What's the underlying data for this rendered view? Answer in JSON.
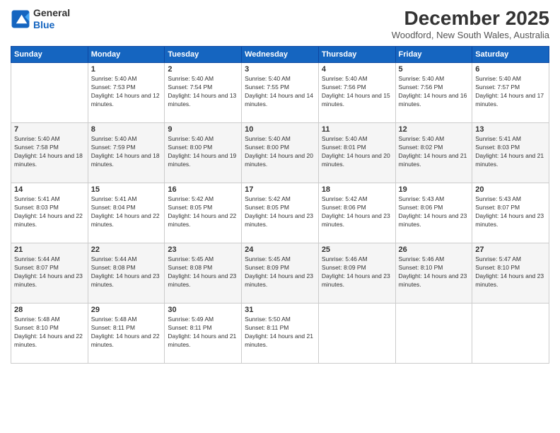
{
  "logo": {
    "line1": "General",
    "line2": "Blue"
  },
  "title": "December 2025",
  "subtitle": "Woodford, New South Wales, Australia",
  "days_header": [
    "Sunday",
    "Monday",
    "Tuesday",
    "Wednesday",
    "Thursday",
    "Friday",
    "Saturday"
  ],
  "weeks": [
    [
      {
        "day": "",
        "sunrise": "",
        "sunset": "",
        "daylight": ""
      },
      {
        "day": "1",
        "sunrise": "Sunrise: 5:40 AM",
        "sunset": "Sunset: 7:53 PM",
        "daylight": "Daylight: 14 hours and 12 minutes."
      },
      {
        "day": "2",
        "sunrise": "Sunrise: 5:40 AM",
        "sunset": "Sunset: 7:54 PM",
        "daylight": "Daylight: 14 hours and 13 minutes."
      },
      {
        "day": "3",
        "sunrise": "Sunrise: 5:40 AM",
        "sunset": "Sunset: 7:55 PM",
        "daylight": "Daylight: 14 hours and 14 minutes."
      },
      {
        "day": "4",
        "sunrise": "Sunrise: 5:40 AM",
        "sunset": "Sunset: 7:56 PM",
        "daylight": "Daylight: 14 hours and 15 minutes."
      },
      {
        "day": "5",
        "sunrise": "Sunrise: 5:40 AM",
        "sunset": "Sunset: 7:56 PM",
        "daylight": "Daylight: 14 hours and 16 minutes."
      },
      {
        "day": "6",
        "sunrise": "Sunrise: 5:40 AM",
        "sunset": "Sunset: 7:57 PM",
        "daylight": "Daylight: 14 hours and 17 minutes."
      }
    ],
    [
      {
        "day": "7",
        "sunrise": "Sunrise: 5:40 AM",
        "sunset": "Sunset: 7:58 PM",
        "daylight": "Daylight: 14 hours and 18 minutes."
      },
      {
        "day": "8",
        "sunrise": "Sunrise: 5:40 AM",
        "sunset": "Sunset: 7:59 PM",
        "daylight": "Daylight: 14 hours and 18 minutes."
      },
      {
        "day": "9",
        "sunrise": "Sunrise: 5:40 AM",
        "sunset": "Sunset: 8:00 PM",
        "daylight": "Daylight: 14 hours and 19 minutes."
      },
      {
        "day": "10",
        "sunrise": "Sunrise: 5:40 AM",
        "sunset": "Sunset: 8:00 PM",
        "daylight": "Daylight: 14 hours and 20 minutes."
      },
      {
        "day": "11",
        "sunrise": "Sunrise: 5:40 AM",
        "sunset": "Sunset: 8:01 PM",
        "daylight": "Daylight: 14 hours and 20 minutes."
      },
      {
        "day": "12",
        "sunrise": "Sunrise: 5:40 AM",
        "sunset": "Sunset: 8:02 PM",
        "daylight": "Daylight: 14 hours and 21 minutes."
      },
      {
        "day": "13",
        "sunrise": "Sunrise: 5:41 AM",
        "sunset": "Sunset: 8:03 PM",
        "daylight": "Daylight: 14 hours and 21 minutes."
      }
    ],
    [
      {
        "day": "14",
        "sunrise": "Sunrise: 5:41 AM",
        "sunset": "Sunset: 8:03 PM",
        "daylight": "Daylight: 14 hours and 22 minutes."
      },
      {
        "day": "15",
        "sunrise": "Sunrise: 5:41 AM",
        "sunset": "Sunset: 8:04 PM",
        "daylight": "Daylight: 14 hours and 22 minutes."
      },
      {
        "day": "16",
        "sunrise": "Sunrise: 5:42 AM",
        "sunset": "Sunset: 8:05 PM",
        "daylight": "Daylight: 14 hours and 22 minutes."
      },
      {
        "day": "17",
        "sunrise": "Sunrise: 5:42 AM",
        "sunset": "Sunset: 8:05 PM",
        "daylight": "Daylight: 14 hours and 23 minutes."
      },
      {
        "day": "18",
        "sunrise": "Sunrise: 5:42 AM",
        "sunset": "Sunset: 8:06 PM",
        "daylight": "Daylight: 14 hours and 23 minutes."
      },
      {
        "day": "19",
        "sunrise": "Sunrise: 5:43 AM",
        "sunset": "Sunset: 8:06 PM",
        "daylight": "Daylight: 14 hours and 23 minutes."
      },
      {
        "day": "20",
        "sunrise": "Sunrise: 5:43 AM",
        "sunset": "Sunset: 8:07 PM",
        "daylight": "Daylight: 14 hours and 23 minutes."
      }
    ],
    [
      {
        "day": "21",
        "sunrise": "Sunrise: 5:44 AM",
        "sunset": "Sunset: 8:07 PM",
        "daylight": "Daylight: 14 hours and 23 minutes."
      },
      {
        "day": "22",
        "sunrise": "Sunrise: 5:44 AM",
        "sunset": "Sunset: 8:08 PM",
        "daylight": "Daylight: 14 hours and 23 minutes."
      },
      {
        "day": "23",
        "sunrise": "Sunrise: 5:45 AM",
        "sunset": "Sunset: 8:08 PM",
        "daylight": "Daylight: 14 hours and 23 minutes."
      },
      {
        "day": "24",
        "sunrise": "Sunrise: 5:45 AM",
        "sunset": "Sunset: 8:09 PM",
        "daylight": "Daylight: 14 hours and 23 minutes."
      },
      {
        "day": "25",
        "sunrise": "Sunrise: 5:46 AM",
        "sunset": "Sunset: 8:09 PM",
        "daylight": "Daylight: 14 hours and 23 minutes."
      },
      {
        "day": "26",
        "sunrise": "Sunrise: 5:46 AM",
        "sunset": "Sunset: 8:10 PM",
        "daylight": "Daylight: 14 hours and 23 minutes."
      },
      {
        "day": "27",
        "sunrise": "Sunrise: 5:47 AM",
        "sunset": "Sunset: 8:10 PM",
        "daylight": "Daylight: 14 hours and 23 minutes."
      }
    ],
    [
      {
        "day": "28",
        "sunrise": "Sunrise: 5:48 AM",
        "sunset": "Sunset: 8:10 PM",
        "daylight": "Daylight: 14 hours and 22 minutes."
      },
      {
        "day": "29",
        "sunrise": "Sunrise: 5:48 AM",
        "sunset": "Sunset: 8:11 PM",
        "daylight": "Daylight: 14 hours and 22 minutes."
      },
      {
        "day": "30",
        "sunrise": "Sunrise: 5:49 AM",
        "sunset": "Sunset: 8:11 PM",
        "daylight": "Daylight: 14 hours and 21 minutes."
      },
      {
        "day": "31",
        "sunrise": "Sunrise: 5:50 AM",
        "sunset": "Sunset: 8:11 PM",
        "daylight": "Daylight: 14 hours and 21 minutes."
      },
      {
        "day": "",
        "sunrise": "",
        "sunset": "",
        "daylight": ""
      },
      {
        "day": "",
        "sunrise": "",
        "sunset": "",
        "daylight": ""
      },
      {
        "day": "",
        "sunrise": "",
        "sunset": "",
        "daylight": ""
      }
    ]
  ]
}
